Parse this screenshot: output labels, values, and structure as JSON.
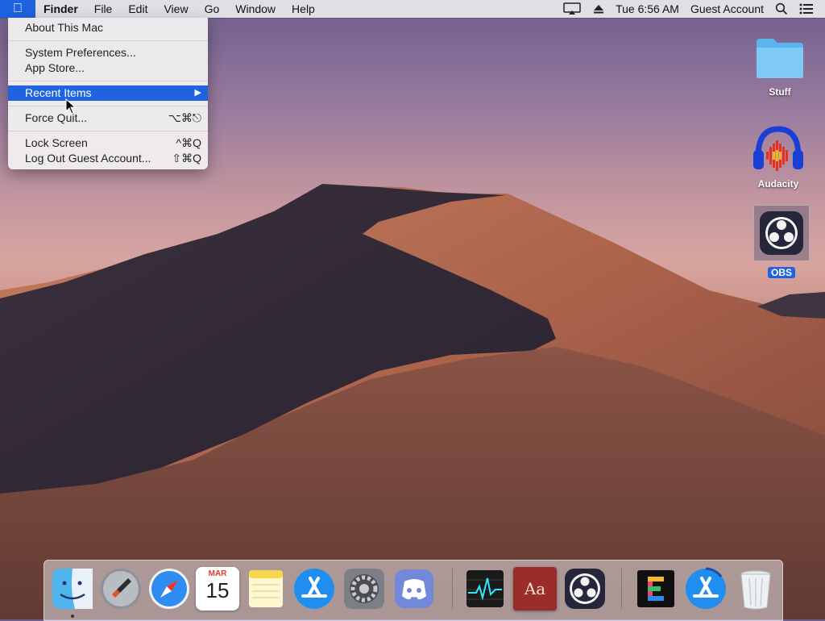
{
  "menubar": {
    "app_name": "Finder",
    "menus": [
      "File",
      "Edit",
      "View",
      "Go",
      "Window",
      "Help"
    ],
    "clock": "Tue 6:56 AM",
    "user": "Guest Account"
  },
  "apple_menu": {
    "items": [
      {
        "label": "About This Mac",
        "shortcut": ""
      },
      {
        "label": "System Preferences...",
        "shortcut": ""
      },
      {
        "label": "App Store...",
        "shortcut": ""
      },
      {
        "label": "Recent Items",
        "shortcut": "▶"
      },
      {
        "label": "Force Quit...",
        "shortcut": "⌥⌘⎋"
      },
      {
        "label": "Lock Screen",
        "shortcut": "^⌘Q"
      },
      {
        "label": "Log Out Guest Account...",
        "shortcut": "⇧⌘Q"
      }
    ]
  },
  "desktop_icons": [
    {
      "label": "Stuff",
      "icon": "folder-icon"
    },
    {
      "label": "Audacity",
      "icon": "audacity-icon"
    },
    {
      "label": "OBS",
      "icon": "obs-icon",
      "selected": true
    }
  ],
  "dock": {
    "calendar_month": "MAR",
    "calendar_day": "15",
    "dictionary_text": "Aa",
    "items": [
      "finder-icon",
      "launchpad-icon",
      "safari-icon",
      "calendar-icon",
      "notes-icon",
      "app-store-icon",
      "system-preferences-icon",
      "discord-icon",
      "activity-monitor-icon",
      "dictionary-icon",
      "obs-icon",
      "epic-icon",
      "app-store-download-icon",
      "trash-icon"
    ]
  },
  "colors": {
    "accent": "#1f63e0",
    "menubar": "#ece9ee"
  }
}
